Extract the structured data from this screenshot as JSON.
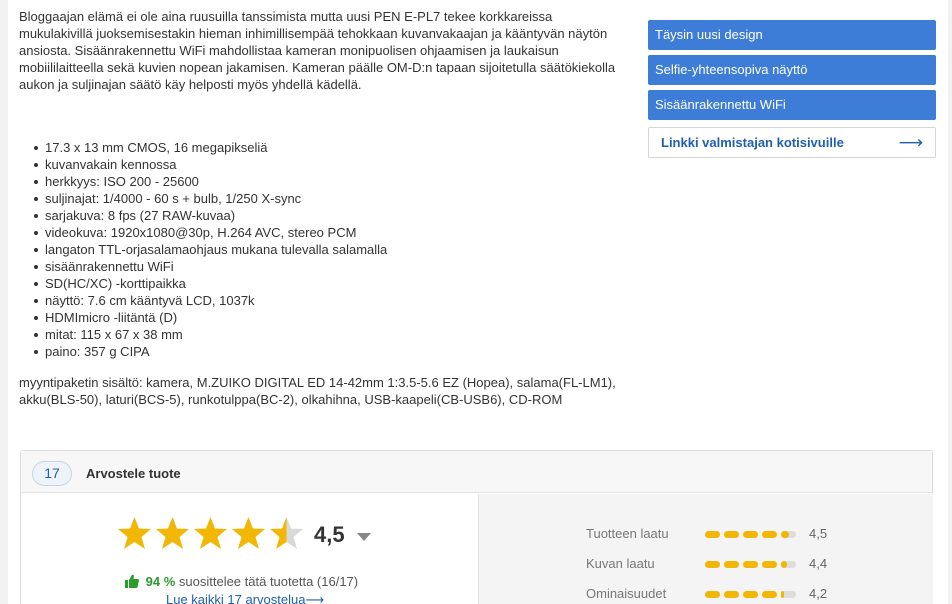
{
  "description": "Bloggaajan elämä ei ole aina ruusuilla tanssimista mutta uusi PEN E-PL7 tekee korkkareissa mukulakivillä juoksemisestakin hieman inhimillisempää tehokkaan kuvanvakaajan ja kääntyvän näytön ansiosta. Sisäänrakennettu WiFi mahdollistaa kameran monipuolisen ohjaamisen ja laukaisun mobiililaitteella sekä kuvien nopean jakamisen. Kameran päälle OM-D:n tapaan sijoitetulla säätökiekolla aukon ja suljinajan säätö käy helposti myös yhdellä kädellä.",
  "specs": [
    "17.3 x 13 mm CMOS, 16 megapikseliä",
    "kuvanvakain kennossa",
    "herkkyys: ISO 200 - 25600",
    "suljinajat: 1/4000 - 60 s + bulb, 1/250 X-sync",
    "sarjakuva: 8 fps (27 RAW-kuvaa)",
    "videokuva: 1920x1080@30p, H.264 AVC, stereo PCM",
    "langaton TTL-orjasalamaohjaus mukana tulevalla salamalla",
    "sisäänrakennettu WiFi",
    "SD(HC/XC) -korttipaikka",
    "näyttö: 7.6 cm kääntyvä LCD, 1037k",
    "HDMImicro -liitäntä (D)",
    "mitat: 115 x 67 x 38 mm",
    "paino: 357 g CIPA"
  ],
  "package": "myyntipaketin sisältö: kamera, M.ZUIKO DIGITAL ED 14-42mm 1:3.5-5.6 EZ (Hopea), salama(FL-LM1), akku(BLS-50), laturi(BCS-5), runkotulppa(BC-2), olkahihna, USB-kaapeli(CB-USB6), CD-ROM",
  "features": [
    "Täysin uusi design",
    "Selfie-yhteensopiva näyttö",
    "Sisäänrakennettu WiFi"
  ],
  "manufacturer_link": "Linkki valmistajan kotisivuille",
  "reviews": {
    "count": "17",
    "title": "Arvostele tuote",
    "score_text": "4,5",
    "score_value": 4.5,
    "recommend_pct": "94 %",
    "recommend_text": "suosittelee tätä tuotetta (16/17)",
    "read_all": "Lue kaikki 17 arvostelua",
    "metrics": [
      {
        "label": "Tuotteen laatu",
        "value_text": "4,5",
        "value": 4.5
      },
      {
        "label": "Kuvan laatu",
        "value_text": "4,4",
        "value": 4.4
      },
      {
        "label": "Ominaisuudet",
        "value_text": "4,2",
        "value": 4.2
      }
    ]
  },
  "colors": {
    "feature_button": "#3d7dd8",
    "link": "#1f5fb0",
    "star": "#f2b705",
    "recommend": "#2a9d2a"
  }
}
